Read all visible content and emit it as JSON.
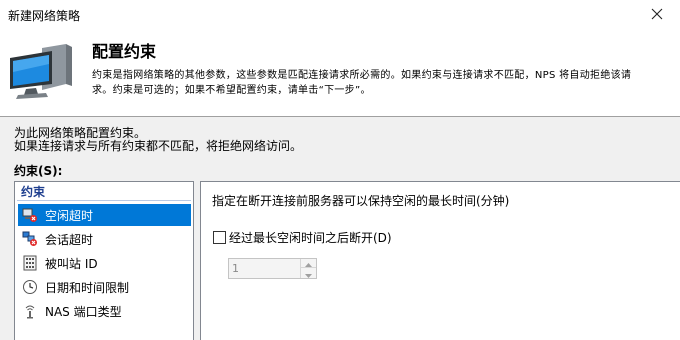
{
  "window": {
    "title": "新建网络策略",
    "close_icon": "close-icon"
  },
  "header": {
    "icon": "server-monitor-icon",
    "title": "配置约束",
    "description_line1": "约束是指网络策略的其他参数，这些参数是匹配连接请求所必需的。如果约束与连接请求不匹配，NPS 将自动拒绝该请",
    "description_line2": "求。约束是可选的；如果不希望配置约束，请单击“下一步”。"
  },
  "instructions": {
    "line1": "为此网络策略配置约束。",
    "line2": "如果连接请求与所有约束都不匹配，将拒绝网络访问。"
  },
  "constraints": {
    "label": "约束(S):",
    "group_header": "约束",
    "items": [
      {
        "label": "空闲超时",
        "icon": "idle-timeout-icon",
        "selected": true
      },
      {
        "label": "会话超时",
        "icon": "session-timeout-icon",
        "selected": false
      },
      {
        "label": "被叫站 ID",
        "icon": "called-station-id-icon",
        "selected": false
      },
      {
        "label": "日期和时间限制",
        "icon": "clock-icon",
        "selected": false
      },
      {
        "label": "NAS 端口类型",
        "icon": "nas-port-type-icon",
        "selected": false
      }
    ]
  },
  "detail": {
    "prompt": "指定在断开连接前服务器可以保持空闲的最长时间(分钟)",
    "checkbox_label": "经过最长空闲时间之后断开(D)",
    "checkbox_checked": false,
    "spinner_value": "1",
    "spinner_enabled": false
  },
  "colors": {
    "selection": "#0078d7",
    "group_header_text": "#1f3f8f",
    "window_bg": "#f0f0f0"
  }
}
